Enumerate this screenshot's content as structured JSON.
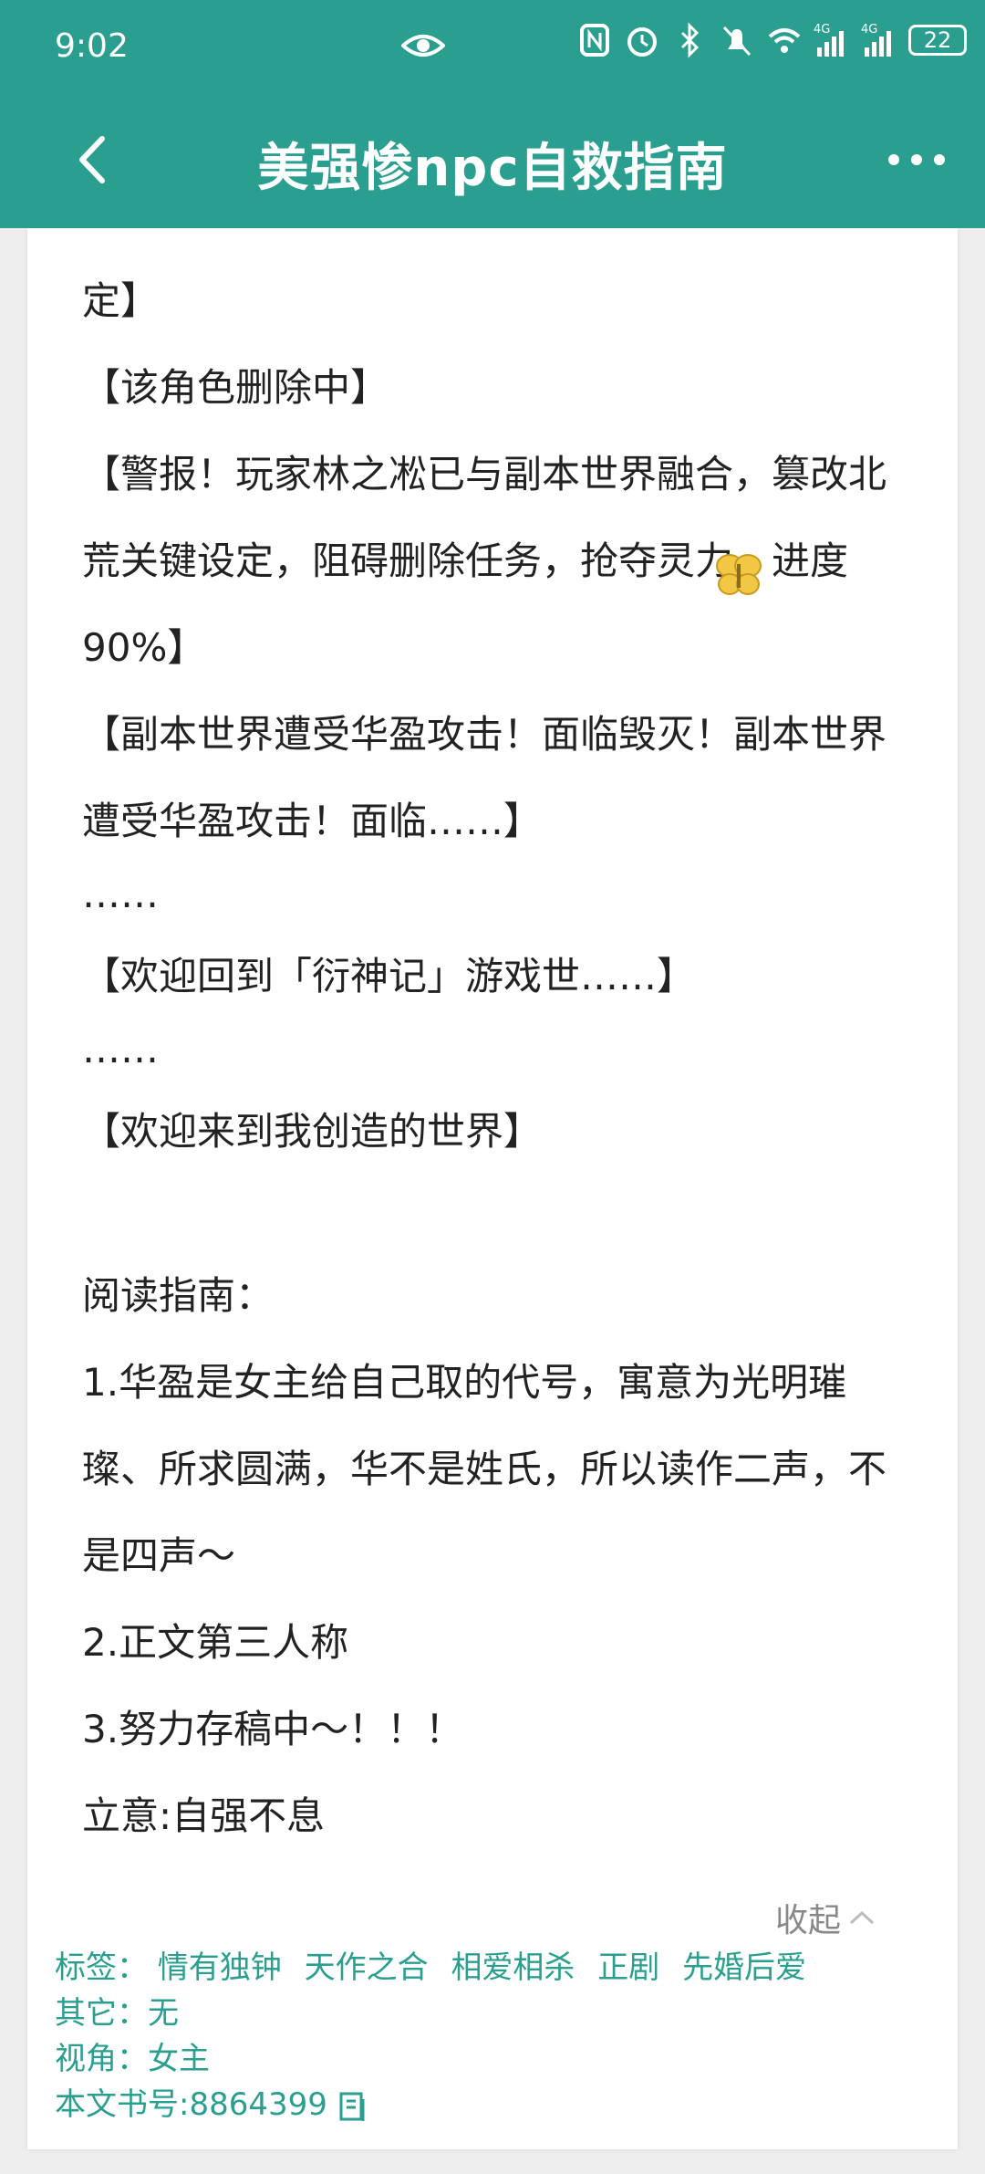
{
  "status_bar": {
    "time": "9:02",
    "battery": "22",
    "icons": [
      "eye-icon",
      "nfc-icon",
      "alarm-icon",
      "bluetooth-icon",
      "mute-icon",
      "wifi-icon",
      "signal-4g-icon",
      "signal-4g-icon"
    ]
  },
  "header": {
    "title": "美强惨npc自救指南"
  },
  "intro": {
    "lines": [
      "定】",
      "【该角色删除中】",
      "【警报！玩家林之凇已与副本世界融合，篡改北",
      "荒关键设定，阻碍删除任务，抢夺灵力，进度",
      "90%】",
      "【副本世界遭受华盈攻击！面临毁灭！副本世界",
      "遭受华盈攻击！面临……】",
      "……",
      "【欢迎回到「衍神记」游戏世……】",
      "……",
      "【欢迎来到我创造的世界】",
      "阅读指南：",
      "1.华盈是女主给自己取的代号，寓意为光明璀",
      "璨、所求圆满，华不是姓氏，所以读作二声，不",
      "是四声～",
      "2.正文第三人称",
      "3.努力存稿中～！！！",
      "立意:自强不息"
    ],
    "collapse_label": "收起"
  },
  "meta": {
    "tags_label": "标签：",
    "tags": [
      "情有独钟",
      "天作之合",
      "相爱相杀",
      "正剧",
      "先婚后爱"
    ],
    "other": "其它：无",
    "perspective": "视角：女主",
    "book_id": "本文书号:8864399"
  },
  "colors": {
    "accent": "#2b9f8f",
    "text": "#222222",
    "muted": "#888888"
  }
}
